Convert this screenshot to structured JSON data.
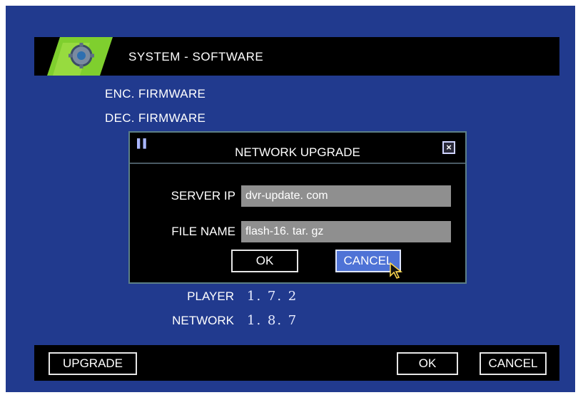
{
  "window": {
    "title": "SYSTEM - SOFTWARE"
  },
  "menu": {
    "enc_firmware": "ENC.  FIRMWARE",
    "dec_firmware": "DEC.  FIRMWARE"
  },
  "versions": [
    {
      "label": "PLAYER",
      "value": "1. 7. 2"
    },
    {
      "label": "NETWORK",
      "value": "1. 8. 7"
    }
  ],
  "dialog": {
    "title": "NETWORK UPGRADE",
    "close_icon": "close-icon",
    "server_ip_label": "SERVER IP",
    "server_ip_value": "dvr-update. com",
    "file_name_label": "FILE  NAME",
    "file_name_value": "flash-16. tar. gz",
    "ok_label": "OK",
    "cancel_label": "CANCEL"
  },
  "bottom": {
    "upgrade_label": "UPGRADE",
    "ok_label": "OK",
    "cancel_label": "CANCEL"
  },
  "colors": {
    "background": "#213a8e",
    "bar": "#000000",
    "selected_button": "#4f73d6",
    "field": "#8f8f8f"
  }
}
